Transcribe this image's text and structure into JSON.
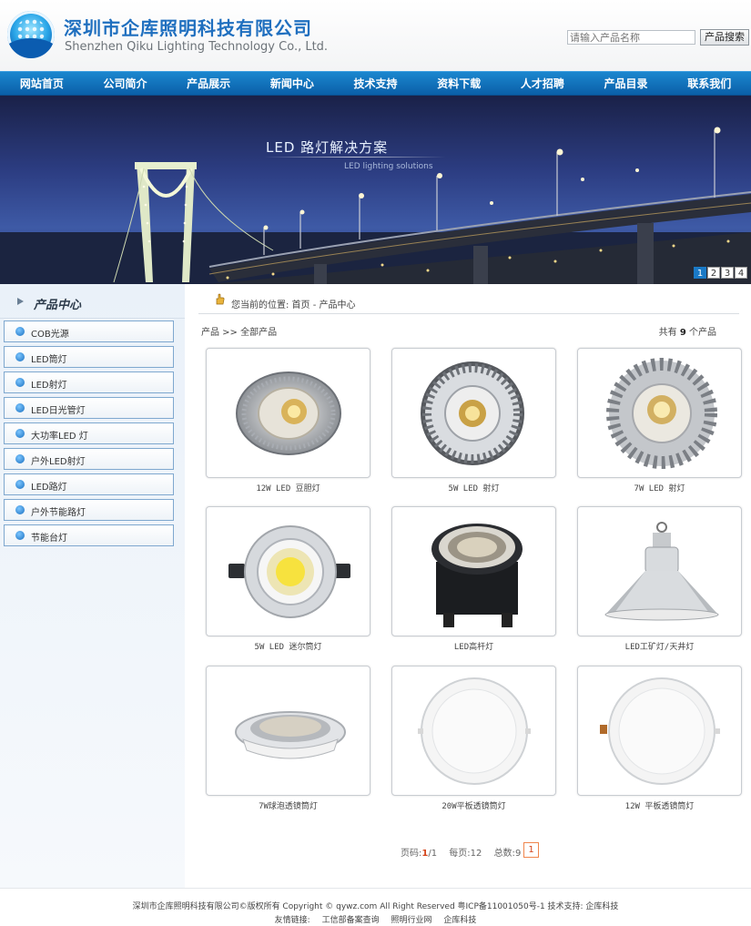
{
  "header": {
    "company_cn": "深圳市企库照明科技有限公司",
    "company_en": "Shenzhen Qiku Lighting Technology Co., Ltd.",
    "search_placeholder": "请输入产品名称",
    "search_button": "产品搜索"
  },
  "nav": [
    "网站首页",
    "公司简介",
    "产品展示",
    "新闻中心",
    "技术支持",
    "资料下载",
    "人才招聘",
    "产品目录",
    "联系我们"
  ],
  "banner": {
    "title": "LED 路灯解决方案",
    "subtitle": "LED lighting solutions",
    "pages": [
      "1",
      "2",
      "3",
      "4"
    ],
    "active_page": "1"
  },
  "sidebar": {
    "title": "产品中心",
    "categories": [
      "COB光源",
      "LED筒灯",
      "LED射灯",
      "LED日光管灯",
      "大功率LED 灯",
      "户外LED射灯",
      "LED路灯",
      "户外节能路灯",
      "节能台灯"
    ]
  },
  "main": {
    "location": "您当前的位置: 首页 - 产品中心",
    "breadcrumb": "产品 >> 全部产品",
    "count_prefix": "共有",
    "count_value": "9",
    "count_suffix": "个产品",
    "products": [
      {
        "name": "12W LED 豆胆灯",
        "icon": "heatsink-spotlight-icon"
      },
      {
        "name": "5W LED 射灯",
        "icon": "fin-spotlight-icon"
      },
      {
        "name": "7W LED 射灯",
        "icon": "fin-spotlight-icon"
      },
      {
        "name": "5W LED 迷尔筒灯",
        "icon": "mini-downlight-icon"
      },
      {
        "name": "LED高杆灯",
        "icon": "high-pole-lamp-icon"
      },
      {
        "name": "LED工矿灯/天井灯",
        "icon": "highbay-lamp-icon"
      },
      {
        "name": "7W球泡透镜筒灯",
        "icon": "lens-downlight-icon"
      },
      {
        "name": "20W平板透镜筒灯",
        "icon": "panel-downlight-icon"
      },
      {
        "name": "12W 平板透镜筒灯",
        "icon": "panel-downlight-icon"
      }
    ]
  },
  "pagination": {
    "page_label": "页码:",
    "current": "1",
    "total_pages": "/1",
    "per_page_label": "每页:",
    "per_page": "12",
    "total_label": "总数:",
    "total": "9",
    "current_button": "1"
  },
  "footer": {
    "line1": "深圳市企库照明科技有限公司©版权所有 Copyright © qywz.com All Right Reserved  粤ICP备11001050号-1  技术支持: 企库科技",
    "links_label": "友情链接:",
    "links": [
      "工信部备案查询",
      "照明行业网",
      "企库科技"
    ]
  },
  "colors": {
    "nav_blue": "#0a5fa8",
    "brand_blue": "#1f6fbf",
    "page_accent": "#d4451c"
  }
}
